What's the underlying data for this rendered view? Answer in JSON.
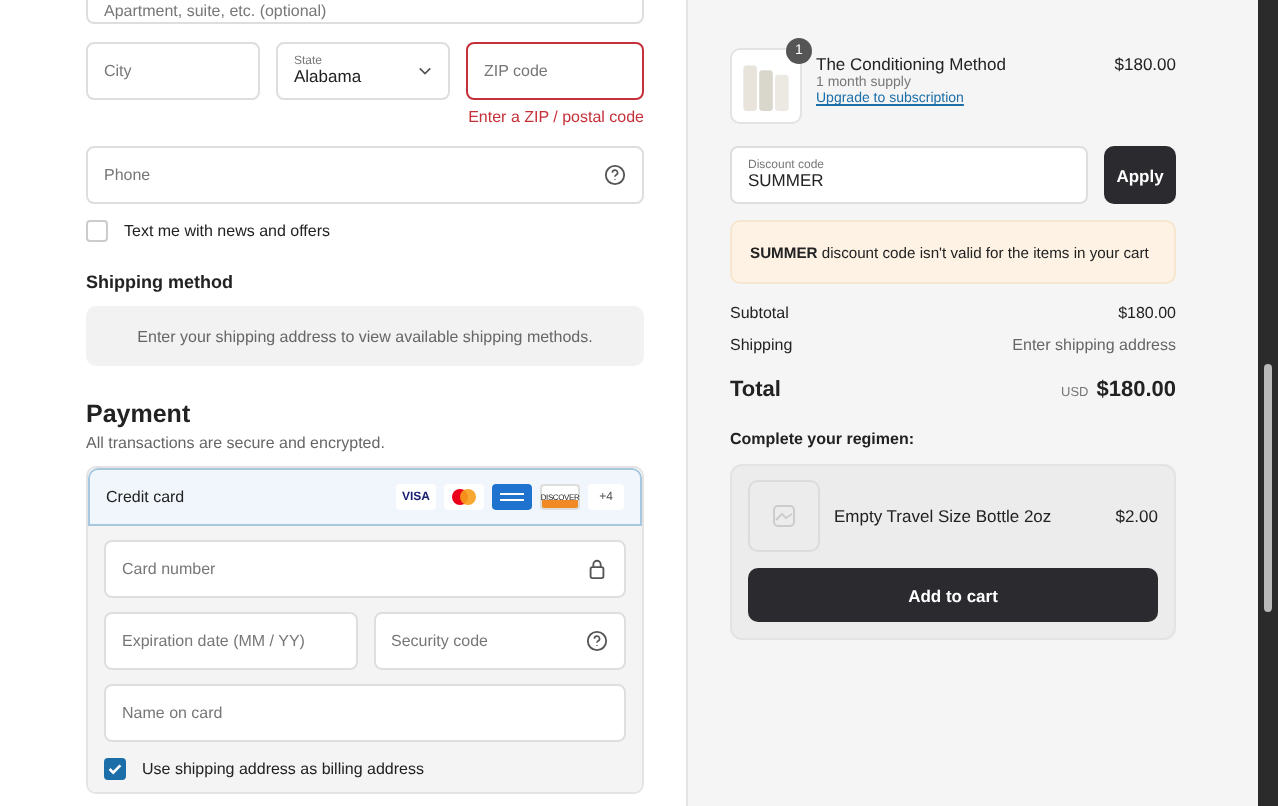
{
  "address": {
    "apartment_placeholder": "Apartment, suite, etc. (optional)",
    "city_placeholder": "City",
    "state": {
      "label": "State",
      "value": "Alabama"
    },
    "zip": {
      "placeholder": "ZIP code",
      "error": "Enter a ZIP / postal code"
    },
    "phone_placeholder": "Phone"
  },
  "marketing_opt_in": {
    "label": "Text me with news and offers",
    "checked": false
  },
  "shipping_method": {
    "title": "Shipping method",
    "message": "Enter your shipping address to view available shipping methods."
  },
  "payment": {
    "title": "Payment",
    "subtitle": "All transactions are secure and encrypted.",
    "method": {
      "label": "Credit card",
      "selected": true,
      "card_logos": [
        {
          "kind": "visa",
          "text": "VISA"
        },
        {
          "kind": "mastercard"
        },
        {
          "kind": "amex"
        },
        {
          "kind": "discover",
          "text": "DISCOVER"
        }
      ],
      "more": "+4"
    },
    "card_number_placeholder": "Card number",
    "expiration_placeholder": "Expiration date (MM / YY)",
    "security_code_placeholder": "Security code",
    "name_placeholder": "Name on card",
    "billing_same": {
      "label": "Use shipping address as billing address",
      "checked": true
    }
  },
  "order": {
    "product": {
      "quantity": "1",
      "name": "The Conditioning Method",
      "variant": "1 month supply",
      "link": "Upgrade to subscription",
      "price": "$180.00"
    },
    "discount": {
      "label": "Discount code",
      "value": "SUMMER",
      "button": "Apply"
    },
    "notice": "**SUMMER** discount code isn't valid for the items in your cart",
    "summary": [
      {
        "label": "Subtotal",
        "value": "$180.00",
        "kind": "amount"
      },
      {
        "label": "Shipping",
        "value": "Enter shipping address",
        "kind": "pending"
      }
    ],
    "total": {
      "label": "Total",
      "currency": "USD",
      "value": "$180.00"
    },
    "upsell": {
      "title": "Complete your regimen:",
      "item": "Empty Travel Size Bottle 2oz",
      "price": "$2.00",
      "button": "Add to cart"
    }
  }
}
